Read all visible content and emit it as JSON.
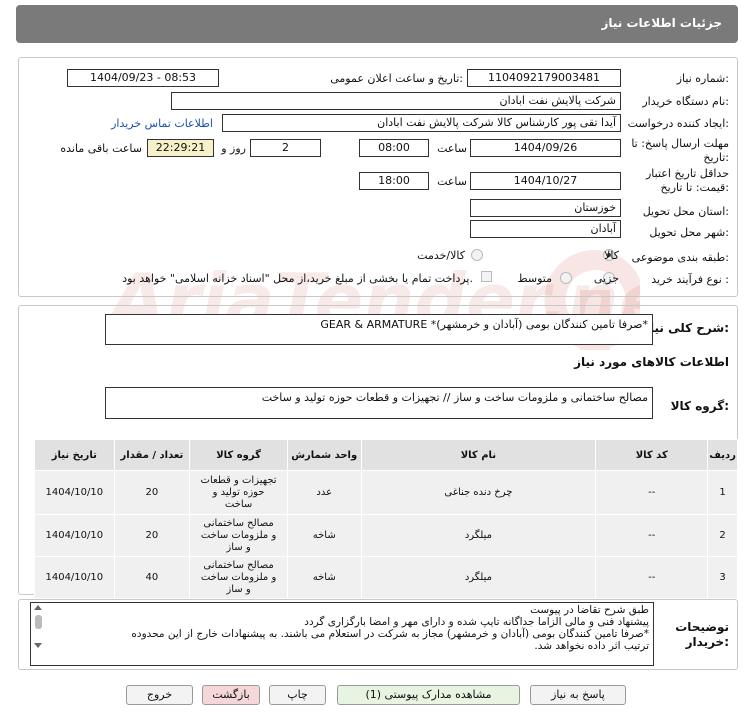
{
  "header": {
    "title": "جزئیات اطلاعات نیاز"
  },
  "fields": {
    "need_number_label": "شماره نیاز:",
    "need_number": "1104092179003481",
    "announce_label": "تاریخ و ساعت اعلان عمومی:",
    "announce_value": "1404/09/23 - 08:53",
    "buyer_org_label": "نام دستگاه خریدار:",
    "buyer_org": "شرکت پالایش نفت ابادان",
    "requester_label": "ایجاد کننده درخواست:",
    "requester": "آیدا تقی پور کارشناس کالا شرکت پالایش نفت ابادان",
    "contact_link": "اطلاعات تماس خریدار",
    "deadline_label_1": "مهلت ارسال پاسخ: تا",
    "deadline_label_2": "تاریخ:",
    "deadline_date": "1404/09/26",
    "time_label": "ساعت",
    "deadline_time": "08:00",
    "days": "2",
    "days_label": "روز و",
    "remaining_time": "22:29:21",
    "remaining_label": "ساعت باقی مانده",
    "validity_label_1": "حداقل تاریخ اعتبار",
    "validity_label_2": "قیمت: تا تاریخ:",
    "validity_date": "1404/10/27",
    "validity_time": "18:00",
    "province_label": "استان محل تحویل:",
    "province": "خوزستان",
    "city_label": "شهر محل تحویل:",
    "city": "آبادان",
    "category_label": "طبقه بندی موضوعی:",
    "category_options": [
      "کالا",
      "کالا/خدمت"
    ],
    "process_label": "نوع فرآیند خرید :",
    "process_options": [
      "جزیی",
      "متوسط"
    ],
    "payment_note": "پرداخت تمام یا بخشی از مبلغ خرید،از محل \"اسناد خزانه اسلامی\" خواهد بود."
  },
  "summary": {
    "label": "شرح کلی نیاز:",
    "value": "GEAR & ARMATURE *صرفا تامین کنندگان بومی (آبادان و خرمشهر)*"
  },
  "goods": {
    "section_title": "اطلاعات کالاهای مورد نیاز",
    "group_label": "گروه کالا:",
    "group_value": "مصالح ساختمانی و ملزومات ساخت و ساز // تجهیزات و قطعات حوزه تولید و ساخت"
  },
  "table": {
    "headers": [
      "ردیف",
      "کد کالا",
      "نام کالا",
      "واحد شمارش",
      "گروه کالا",
      "تعداد / مقدار",
      "تاریخ نیاز"
    ],
    "rows": [
      {
        "row": "1",
        "code": "--",
        "name": "چرخ دنده جناغی",
        "unit": "عدد",
        "group": [
          "تجهیزات و قطعات",
          "حوزه تولید و",
          "ساخت"
        ],
        "qty": "20",
        "date": "1404/10/10"
      },
      {
        "row": "2",
        "code": "--",
        "name": "میلگرد",
        "unit": "شاخه",
        "group": [
          "مصالح ساختمانی",
          "و ملزومات ساخت",
          "و ساز"
        ],
        "qty": "20",
        "date": "1404/10/10"
      },
      {
        "row": "3",
        "code": "--",
        "name": "میلگرد",
        "unit": "شاخه",
        "group": [
          "مصالح ساختمانی",
          "و ملزومات ساخت",
          "و ساز"
        ],
        "qty": "40",
        "date": "1404/10/10"
      }
    ]
  },
  "notes": {
    "label_1": "توضیحات",
    "label_2": "خریدار:",
    "lines": [
      "طبق شرح تقاضا در پیوست",
      "پیشنهاد فنی و مالی الزاما جداگانه تایپ شده و دارای مهر و امضا بارگزاری گردد",
      "*صرفا تامین کنندگان بومی (آبادان و خرمشهر) مجاز به شرکت در استعلام می باشند. به پیشنهادات خارج از این محدوده",
      "ترتیب اثر داده نخواهد شد."
    ]
  },
  "buttons": {
    "reply": "پاسخ به نیاز",
    "attachments": "مشاهده مدارک پیوستی (1)",
    "print": "چاپ",
    "back": "بازگشت",
    "exit": "خروج"
  },
  "watermark": {
    "text": "AriaTender.neT"
  },
  "colors": {
    "header_bg": "#7a7a7a",
    "link": "#1a4fb5",
    "back_btn": "#f6d7d7",
    "attach_btn": "#e6f4e1"
  }
}
